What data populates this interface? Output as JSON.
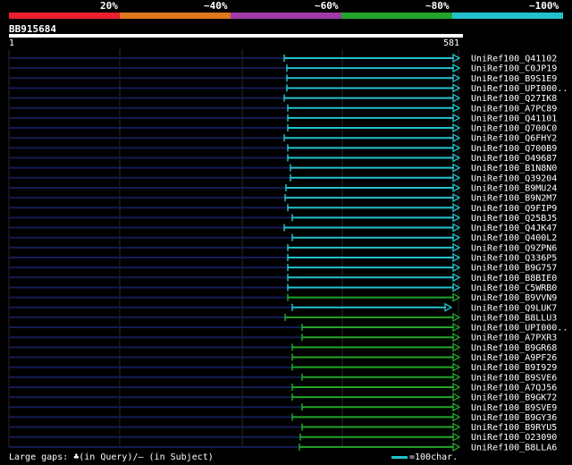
{
  "legend": {
    "labels": [
      "20%",
      "~40%",
      "~60%",
      "~80%",
      "~100%"
    ],
    "colors": [
      "#e8202f",
      "#e0761e",
      "#a03aa8",
      "#22a52a",
      "#22c1cc"
    ]
  },
  "query": {
    "name": "BB915684",
    "start": "1",
    "end": "581"
  },
  "hits": [
    {
      "name": "UniRef100_Q41102",
      "start": 318,
      "color": "#22c1cc"
    },
    {
      "name": "UniRef100_C0JP19",
      "start": 321,
      "color": "#22c1cc"
    },
    {
      "name": "UniRef100_B9S1E9",
      "start": 321,
      "color": "#22c1cc"
    },
    {
      "name": "UniRef100_UPI000..",
      "start": 321,
      "color": "#22c1cc"
    },
    {
      "name": "UniRef100_Q27IK8",
      "start": 318,
      "color": "#22c1cc"
    },
    {
      "name": "UniRef100_A7PC89",
      "start": 322,
      "color": "#22c1cc"
    },
    {
      "name": "UniRef100_Q41101",
      "start": 322,
      "color": "#22c1cc"
    },
    {
      "name": "UniRef100_Q700C0",
      "start": 322,
      "color": "#22c1cc"
    },
    {
      "name": "UniRef100_Q6FHY2",
      "start": 318,
      "color": "#22c1cc"
    },
    {
      "name": "UniRef100_Q700B9",
      "start": 322,
      "color": "#22c1cc"
    },
    {
      "name": "UniRef100_O49687",
      "start": 322,
      "color": "#22c1cc"
    },
    {
      "name": "UniRef100_B1N8N0",
      "start": 325,
      "color": "#22c1cc"
    },
    {
      "name": "UniRef100_Q39204",
      "start": 325,
      "color": "#22c1cc"
    },
    {
      "name": "UniRef100_B9MU24",
      "start": 320,
      "color": "#22c1cc"
    },
    {
      "name": "UniRef100_B9N2M7",
      "start": 319,
      "color": "#22c1cc"
    },
    {
      "name": "UniRef100_Q9FIP9",
      "start": 322,
      "color": "#22c1cc"
    },
    {
      "name": "UniRef100_Q25BJ5",
      "start": 327,
      "color": "#22c1cc"
    },
    {
      "name": "UniRef100_Q4JK47",
      "start": 318,
      "color": "#22c1cc"
    },
    {
      "name": "UniRef100_Q400L2",
      "start": 327,
      "color": "#22c1cc"
    },
    {
      "name": "UniRef100_Q9ZPN6",
      "start": 322,
      "color": "#22c1cc"
    },
    {
      "name": "UniRef100_Q336P5",
      "start": 322,
      "color": "#22c1cc"
    },
    {
      "name": "UniRef100_B9G757",
      "start": 322,
      "color": "#22c1cc"
    },
    {
      "name": "UniRef100_B8BIE0",
      "start": 322,
      "color": "#22c1cc"
    },
    {
      "name": "UniRef100_C5WRB0",
      "start": 322,
      "color": "#22c1cc"
    },
    {
      "name": "UniRef100_B9VVN9",
      "start": 322,
      "color": "#22a52a"
    },
    {
      "name": "UniRef100_Q9LUK7",
      "start": 327,
      "color": "#22c1cc",
      "end": 499
    },
    {
      "name": "UniRef100_B8LLU3",
      "start": 319,
      "color": "#22a52a"
    },
    {
      "name": "UniRef100_UPI000..",
      "start": 338,
      "color": "#22a52a"
    },
    {
      "name": "UniRef100_A7PXR3",
      "start": 338,
      "color": "#22a52a"
    },
    {
      "name": "UniRef100_B9GR68",
      "start": 327,
      "color": "#22a52a"
    },
    {
      "name": "UniRef100_A9PF26",
      "start": 327,
      "color": "#22a52a"
    },
    {
      "name": "UniRef100_B9I929",
      "start": 327,
      "color": "#22a52a"
    },
    {
      "name": "UniRef100_B9SVE6",
      "start": 338,
      "color": "#22a52a"
    },
    {
      "name": "UniRef100_A7QJ56",
      "start": 327,
      "color": "#22a52a"
    },
    {
      "name": "UniRef100_B9GK72",
      "start": 327,
      "color": "#22a52a"
    },
    {
      "name": "UniRef100_B9SVE9",
      "start": 338,
      "color": "#22a52a"
    },
    {
      "name": "UniRef100_B9GY36",
      "start": 327,
      "color": "#22a52a"
    },
    {
      "name": "UniRef100_B9RYU5",
      "start": 338,
      "color": "#22a52a"
    },
    {
      "name": "UniRef100_O23090",
      "start": 336,
      "color": "#22a52a"
    },
    {
      "name": "UniRef100_B8LLA6",
      "start": 335,
      "color": "#22a52a"
    }
  ],
  "footer": {
    "left": "Large gaps: ♣(in Query)/– (in Subject)",
    "right": "=100char."
  }
}
